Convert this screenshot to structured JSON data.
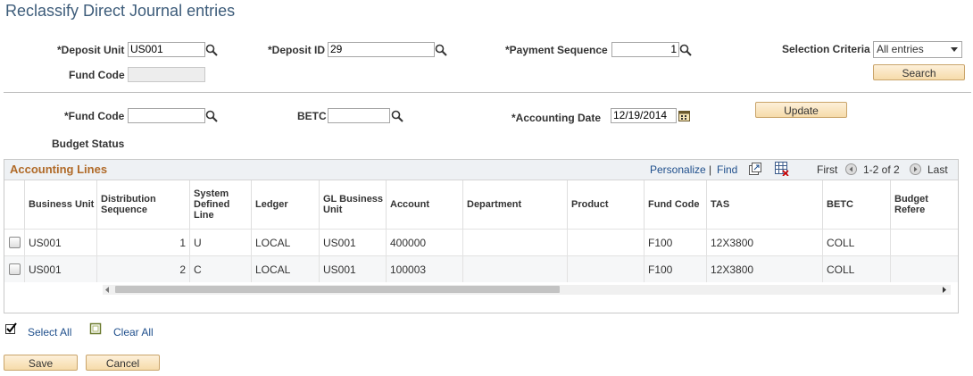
{
  "page": {
    "title": "Reclassify Direct Journal entries"
  },
  "criteria": {
    "deposit_unit_label": "*Deposit Unit",
    "deposit_unit_value": "US001",
    "deposit_id_label": "*Deposit ID",
    "deposit_id_value": "29",
    "payment_sequence_label": "*Payment Sequence",
    "payment_sequence_value": "1",
    "selection_criteria_label": "Selection Criteria",
    "selection_criteria_value": "All entries",
    "fund_code_label": "Fund Code",
    "fund_code_value": "",
    "search_label": "Search"
  },
  "update_section": {
    "fund_code_label": "*Fund Code",
    "fund_code_value": "",
    "betc_label": "BETC",
    "betc_value": "",
    "accounting_date_label": "*Accounting Date",
    "accounting_date_value": "12/19/2014",
    "update_label": "Update",
    "budget_status_label": "Budget Status"
  },
  "grid": {
    "title": "Accounting Lines",
    "personalize": "Personalize",
    "separator": "|",
    "find": "Find",
    "first": "First",
    "range": "1-2 of 2",
    "last": "Last",
    "columns": [
      "Business Unit",
      "Distribution Sequence",
      "System Defined Line",
      "Ledger",
      "GL Business Unit",
      "Account",
      "Department",
      "Product",
      "Fund Code",
      "TAS",
      "BETC",
      "Budget Refere"
    ],
    "rows": [
      {
        "business_unit": "US001",
        "dist_seq": "1",
        "sys_line": "U",
        "ledger": "LOCAL",
        "gl_bu": "US001",
        "account": "400000",
        "department": "",
        "product": "",
        "fund_code": "F100",
        "tas": "12X3800",
        "betc": "COLL",
        "budget_ref": ""
      },
      {
        "business_unit": "US001",
        "dist_seq": "2",
        "sys_line": "C",
        "ledger": "LOCAL",
        "gl_bu": "US001",
        "account": "100003",
        "department": "",
        "product": "",
        "fund_code": "F100",
        "tas": "12X3800",
        "betc": "COLL",
        "budget_ref": ""
      }
    ]
  },
  "footer": {
    "select_all": "Select All",
    "clear_all": "Clear All",
    "save": "Save",
    "cancel": "Cancel"
  },
  "colors": {
    "accent": "#3d5c7a",
    "link": "#1f4f8c",
    "grid_title": "#b06a28",
    "button": "#f6dbaa"
  }
}
